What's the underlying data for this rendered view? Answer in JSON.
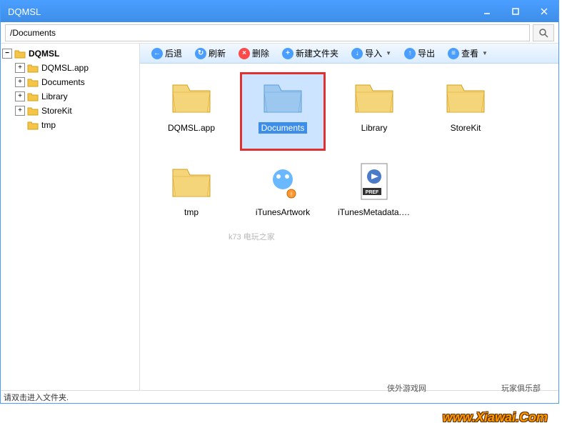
{
  "window": {
    "title": "DQMSL"
  },
  "path": {
    "value": "/Documents"
  },
  "toolbar": {
    "back": "后退",
    "refresh": "刷新",
    "delete": "删除",
    "newfolder": "新建文件夹",
    "import": "导入",
    "export": "导出",
    "view": "查看"
  },
  "tree": {
    "root": "DQMSL",
    "items": [
      "DQMSL.app",
      "Documents",
      "Library",
      "StoreKit",
      "tmp"
    ]
  },
  "grid": {
    "items": [
      {
        "label": "DQMSL.app",
        "type": "folder",
        "selected": false,
        "highlighted": false
      },
      {
        "label": "Documents",
        "type": "folder",
        "selected": true,
        "highlighted": true
      },
      {
        "label": "Library",
        "type": "folder",
        "selected": false,
        "highlighted": false
      },
      {
        "label": "StoreKit",
        "type": "folder",
        "selected": false,
        "highlighted": false
      },
      {
        "label": "tmp",
        "type": "folder",
        "selected": false,
        "highlighted": false
      },
      {
        "label": "iTunesArtwork",
        "type": "file-img",
        "selected": false,
        "highlighted": false
      },
      {
        "label": "iTunesMetadata.p...",
        "type": "file-pref",
        "selected": false,
        "highlighted": false
      }
    ]
  },
  "status": "请双击进入文件夹.",
  "watermarks": {
    "w1": "侠外游戏网",
    "w2": "玩家俱乐部",
    "w3": "www.Xiawai.Com",
    "w4": "k73 电玩之家"
  }
}
